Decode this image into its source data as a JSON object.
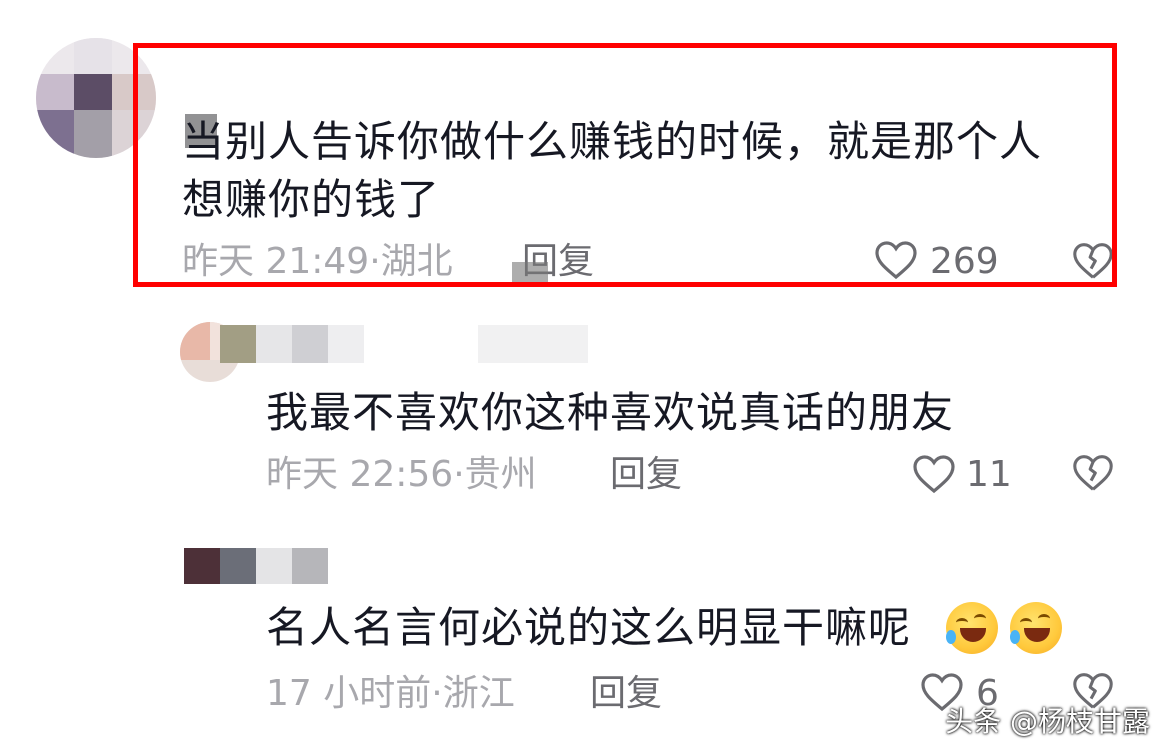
{
  "comments": [
    {
      "text_line1": "当别人告诉你做什么赚钱的时候，就是那个人",
      "text_line2": "想赚你的钱了",
      "time": "昨天 21:49",
      "location": "湖北",
      "reply_label": "回复",
      "likes": "269",
      "highlighted": true
    },
    {
      "text_line1": "我最不喜欢你这种喜欢说真话的朋友",
      "time": "昨天 22:56",
      "location": "贵州",
      "reply_label": "回复",
      "likes": "11"
    },
    {
      "text_line1": "名人名言何必说的这么明显干嘛呢",
      "time": "17 小时前",
      "location": "浙江",
      "reply_label": "回复",
      "likes": "6"
    }
  ],
  "separator": "·",
  "icons": {
    "like": "heart-outline-icon",
    "dislike": "broken-heart-icon",
    "emoji": "rolling-on-floor-laughing-emoji"
  },
  "colors": {
    "highlight_border": "#ff0000",
    "text_primary": "#161823",
    "text_meta": "#a8a8ad",
    "text_action": "#6b6b70"
  },
  "watermark": "头条 @杨枝甘露"
}
